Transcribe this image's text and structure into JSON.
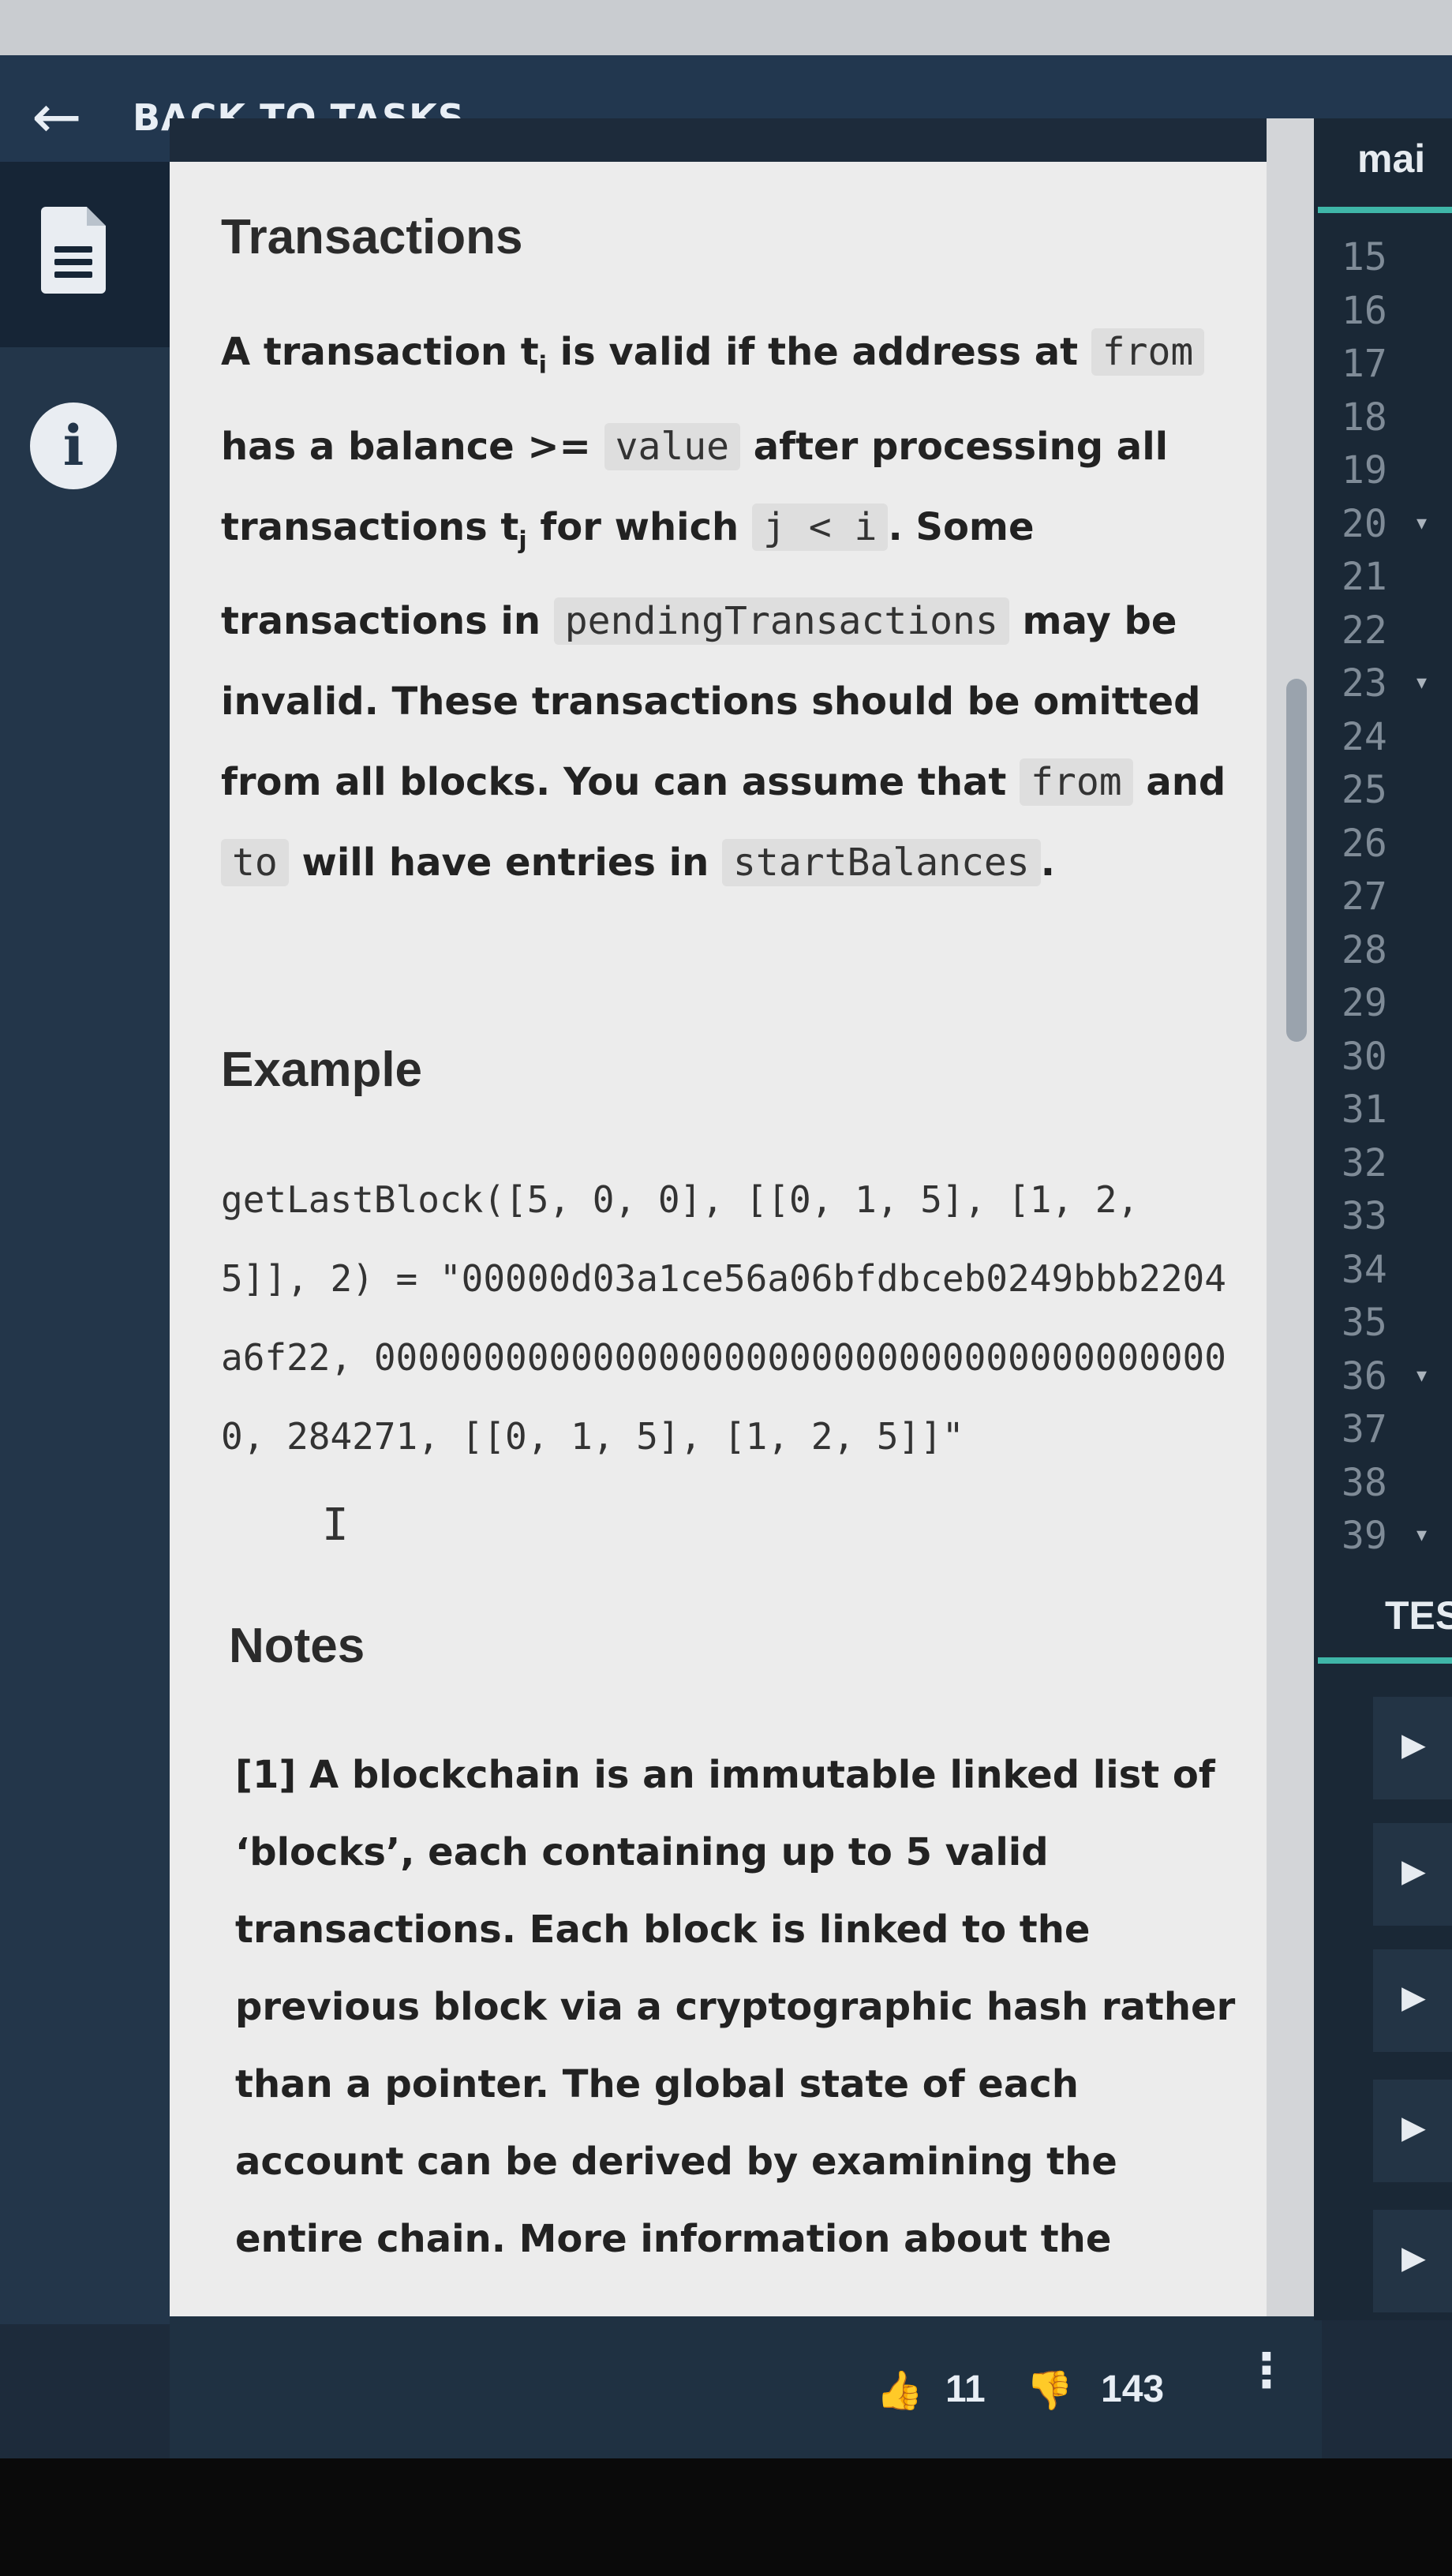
{
  "header": {
    "back_label": "BACK TO TASKS",
    "back_icon": "arrow-left-icon"
  },
  "sidebar": {
    "icons": [
      "document-icon",
      "info-icon"
    ],
    "info_glyph": "i"
  },
  "content": {
    "transactions_heading": "Transactions",
    "p1": {
      "t1": "A transaction ",
      "t2": "t",
      "t3": "i",
      "t4": " is valid if the address at ",
      "code_from": "from",
      "t5": " has a balance >= ",
      "code_value": "value",
      "t6": " after processing all transactions ",
      "t7": "t",
      "t8": "j",
      "t9": " for which ",
      "code_ji": "j < i",
      "t10": ". Some transactions in ",
      "code_pending": "pendingTransactions",
      "t11": " may be invalid. These transactions should be omitted from all blocks. You can assume that ",
      "code_from2": "from",
      "t12": " and ",
      "code_to": "to",
      "t13": " will have entries in ",
      "code_start": "startBalances",
      "t14": "."
    },
    "example_heading": "Example",
    "example_code_1": "getLastBlock([5, 0, 0], [[0, 1, 5], [1, 2, 5]], 2) = ",
    "example_code_2": "\"00000d03a1ce56a06bfdbceb0249bbb2204a6f22, 0000000000000000000000000000000000000000, 284271, [[0, 1, 5], [1, 2, 5]]\"",
    "cursor": "I",
    "notes_heading": "Notes",
    "note1": "[1] A blockchain is an immutable linked list of ‘blocks’, each containing up to 5 valid transactions. Each block is linked to the previous block via a cryptographic hash rather than a pointer. The global state of each account can be derived by examining the entire chain. More information about the"
  },
  "footer": {
    "upvote_icon": "thumbs-up-icon",
    "upvote_count": "11",
    "downvote_icon": "thumbs-down-icon",
    "downvote_count": "143",
    "more_icon": "⋮"
  },
  "editor": {
    "tab_label": "mai",
    "line_numbers": [
      "15",
      "16",
      "17",
      "18",
      "19",
      "20",
      "21",
      "22",
      "23",
      "24",
      "25",
      "26",
      "27",
      "28",
      "29",
      "30",
      "31",
      "32",
      "33",
      "34",
      "35",
      "36",
      "37",
      "38",
      "39"
    ],
    "folded_lines": [
      "20",
      "23",
      "36",
      "39"
    ],
    "fold_glyph": "▾",
    "tests_label": "TES",
    "test_arrow": "▶"
  }
}
